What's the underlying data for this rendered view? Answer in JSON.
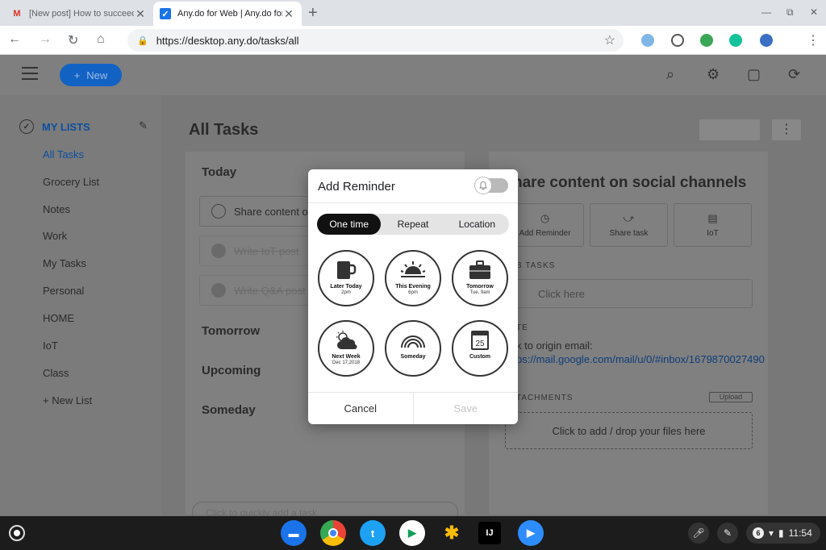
{
  "browser": {
    "tabs": [
      {
        "title": "[New post] How to succeed bo",
        "icon": "gmail-icon"
      },
      {
        "title": "Any.do for Web | Any.do for De",
        "icon": "anydo-icon"
      }
    ],
    "url": "https://desktop.any.do/tasks/all"
  },
  "app": {
    "new_button": "New",
    "sidebar": {
      "header": "MY LISTS",
      "items": [
        "All Tasks",
        "Grocery List",
        "Notes",
        "Work",
        "My Tasks",
        "Personal",
        "HOME",
        "IoT",
        "Class"
      ],
      "new_list": "+ New List"
    },
    "page_title": "All Tasks",
    "sections": [
      "Today",
      "Tomorrow",
      "Upcoming",
      "Someday"
    ],
    "tasks": [
      {
        "title": "Share content on",
        "done": false
      },
      {
        "title": "Write IoT post",
        "done": true
      },
      {
        "title": "Write Q&A post",
        "done": true
      }
    ],
    "quick_add_placeholder": "Click to quickly add a task",
    "detail": {
      "title": "hare content on social channels",
      "buttons": [
        "Add Reminder",
        "Share task",
        "IoT"
      ],
      "subtasks_label": "B TASKS",
      "subtask_placeholder": "Click here",
      "note_label": "TE",
      "note_line1": "k to origin email:",
      "note_line2": "ps://mail.google.com/mail/u/0/#inbox/1679870027490",
      "attachments_label": "TACHMENTS",
      "upload": "Upload",
      "dropzone": "Click to add / drop your files here"
    }
  },
  "modal": {
    "title": "Add Reminder",
    "tabs": [
      "One time",
      "Repeat",
      "Location"
    ],
    "selected_tab": "One time",
    "options": [
      {
        "label": "Later Today",
        "sub": "2pm",
        "icon": "mug-icon"
      },
      {
        "label": "This Evening",
        "sub": "6pm",
        "icon": "sunset-icon"
      },
      {
        "label": "Tomorrow",
        "sub": "Tue, 9am",
        "icon": "briefcase-icon"
      },
      {
        "label": "Next Week",
        "sub": "Dec 17,2018",
        "icon": "cloud-sun-icon"
      },
      {
        "label": "Someday",
        "sub": "",
        "icon": "rainbow-icon"
      },
      {
        "label": "Custom",
        "sub": "",
        "calendar_day": "25",
        "icon": "calendar-icon"
      }
    ],
    "cancel": "Cancel",
    "save": "Save"
  },
  "shelf": {
    "notification_count": "6",
    "time": "11:54"
  }
}
